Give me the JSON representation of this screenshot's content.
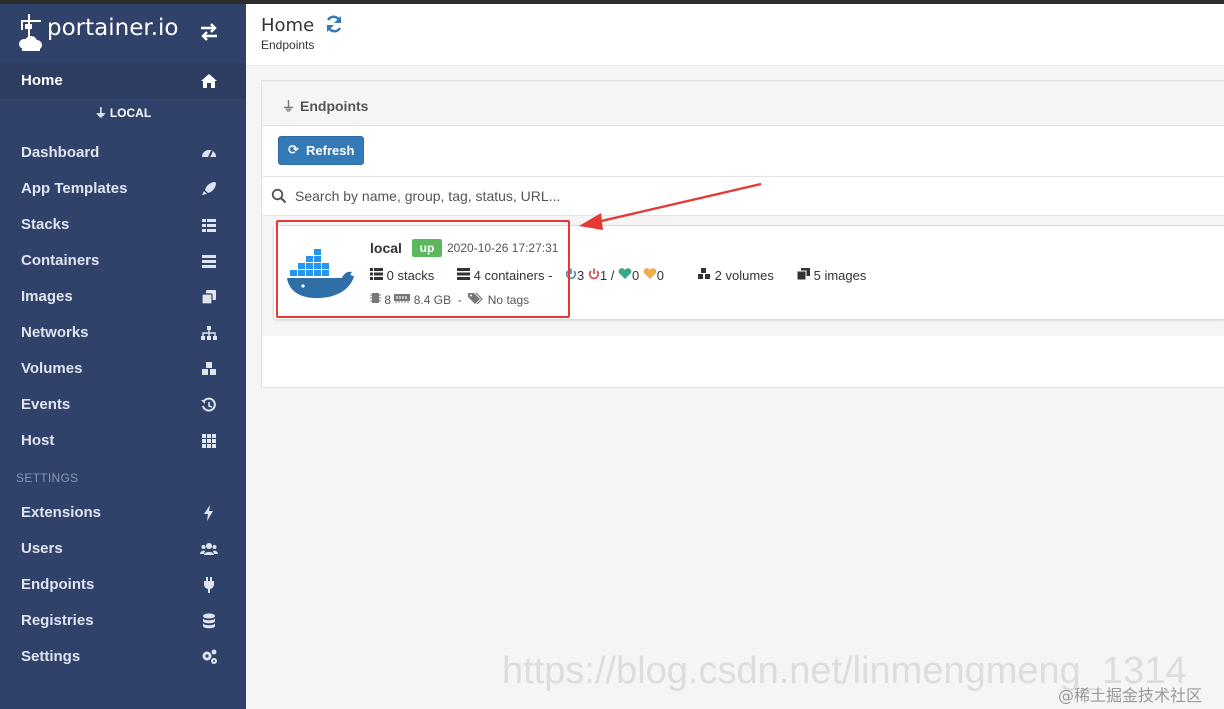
{
  "app": {
    "brand": "portainer.io"
  },
  "sidebar": {
    "home": {
      "label": "Home"
    },
    "endpoint_name": "LOCAL",
    "items": [
      {
        "label": "Dashboard",
        "icon": "tachometer-icon"
      },
      {
        "label": "App Templates",
        "icon": "rocket-icon"
      },
      {
        "label": "Stacks",
        "icon": "th-list-icon"
      },
      {
        "label": "Containers",
        "icon": "server-icon"
      },
      {
        "label": "Images",
        "icon": "clone-icon"
      },
      {
        "label": "Networks",
        "icon": "sitemap-icon"
      },
      {
        "label": "Volumes",
        "icon": "cubes-icon"
      },
      {
        "label": "Events",
        "icon": "history-icon"
      },
      {
        "label": "Host",
        "icon": "th-icon"
      }
    ],
    "settings_section": "SETTINGS",
    "settings_items": [
      {
        "label": "Extensions",
        "icon": "bolt-icon"
      },
      {
        "label": "Users",
        "icon": "users-icon"
      },
      {
        "label": "Endpoints",
        "icon": "plug-icon"
      },
      {
        "label": "Registries",
        "icon": "database-icon"
      },
      {
        "label": "Settings",
        "icon": "cogs-icon"
      }
    ]
  },
  "header": {
    "title": "Home",
    "breadcrumb": "Endpoints"
  },
  "widget": {
    "title": "Endpoints",
    "refresh_label": "Refresh",
    "search_placeholder": "Search by name, group, tag, status, URL..."
  },
  "endpoint": {
    "name": "local",
    "status": "up",
    "timestamp": "2020-10-26 17:27:31",
    "stacks": "0 stacks",
    "containers": "4 containers",
    "running": "3",
    "stopped": "1",
    "healthy": "0",
    "unhealthy": "0",
    "volumes": "2 volumes",
    "images": "5 images",
    "cpu": "8",
    "memory": "8.4 GB",
    "tags": "No tags"
  },
  "colors": {
    "sidebar_bg": "#30426a",
    "accent": "#337ab7",
    "status_up": "#5cb85c",
    "annotation": "#e53935"
  },
  "watermark": "https://blog.csdn.net/linmengmeng_1314",
  "footer_mark": "@稀土掘金技术社区"
}
